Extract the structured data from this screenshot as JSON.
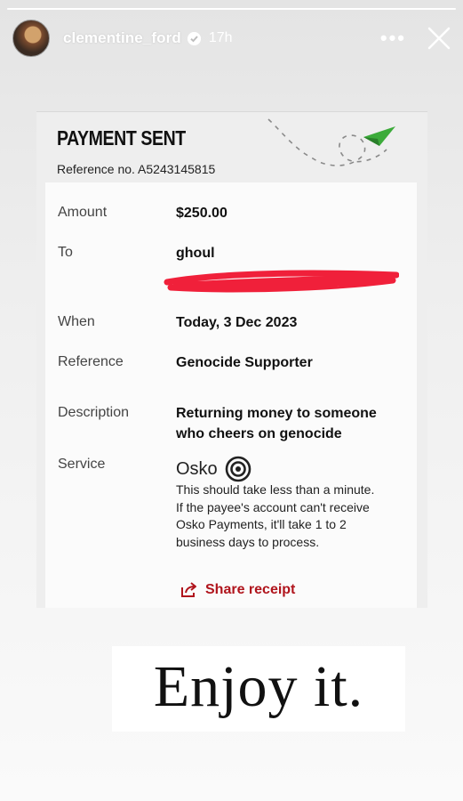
{
  "story": {
    "progress": 1.0,
    "username": "clementine_ford",
    "time": "17h",
    "more_icon": "more-horizontal-icon",
    "close_icon": "close-icon",
    "verified_icon": "verified-badge-icon"
  },
  "receipt": {
    "title": "PAYMENT SENT",
    "reference_no": "Reference no. A5243145815",
    "rows": {
      "amount": {
        "label": "Amount",
        "value": "$250.00"
      },
      "to": {
        "label": "To",
        "value": "ghoul"
      },
      "when": {
        "label": "When",
        "value": "Today, 3 Dec 2023"
      },
      "reference": {
        "label": "Reference",
        "value": "Genocide Supporter"
      },
      "description": {
        "label": "Description",
        "value_line1": "Returning money to someone",
        "value_line2": "who cheers on genocide"
      },
      "service": {
        "label": "Service",
        "name": "Osko",
        "note_lines": [
          "This should take less than a minute.",
          "If the payee's account can't receive",
          "Osko Payments, it'll take 1 to 2",
          "business days to process."
        ]
      }
    },
    "share_label": "Share receipt",
    "accent_color": "#b0141c",
    "redaction_color": "#f0203a"
  },
  "caption": {
    "text": "Enjoy it."
  }
}
